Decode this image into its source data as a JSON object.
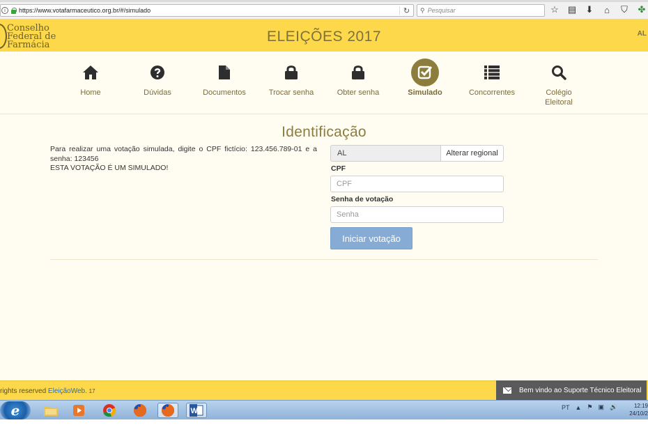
{
  "browser": {
    "url": "https://www.votafarmaceutico.org.br/#/simulado",
    "search_placeholder": "Pesquisar"
  },
  "header": {
    "logo_lines": [
      "Conselho",
      "Federal de",
      "Farmácia"
    ],
    "title": "ELEIÇÕES 2017",
    "region_code": "AL"
  },
  "nav": {
    "items": [
      {
        "label": "Home",
        "icon": "home-icon"
      },
      {
        "label": "Dúvidas",
        "icon": "question-icon"
      },
      {
        "label": "Documentos",
        "icon": "document-icon"
      },
      {
        "label": "Trocar senha",
        "icon": "lock-icon"
      },
      {
        "label": "Obter senha",
        "icon": "lock-icon"
      },
      {
        "label": "Simulado",
        "icon": "check-square-icon",
        "active": true
      },
      {
        "label": "Concorrentes",
        "icon": "list-icon"
      },
      {
        "label": "Colégio Eleitoral",
        "icon": "search-icon"
      }
    ]
  },
  "identification": {
    "title": "Identificação",
    "instructions": "Para realizar uma votação simulada, digite o CPF fictício: 123.456.789-01 e a senha: 123456",
    "warning": "ESTA VOTAÇÃO É UM SIMULADO!",
    "region_value": "AL",
    "change_region_label": "Alterar regional",
    "cpf_label": "CPF",
    "cpf_placeholder": "CPF",
    "password_label": "Senha de votação",
    "password_placeholder": "Senha",
    "start_button": "Iniciar votação"
  },
  "footer": {
    "text": "rights reserved",
    "link": "EleiçãoWeb.",
    "year": "17",
    "support": "Bem vindo ao Suporte Técnico Eleitoral"
  },
  "taskbar": {
    "language": "PT",
    "time": "12:19",
    "date": "24/10/2"
  },
  "colors": {
    "header_bg": "#fcd84a",
    "accent": "#8c7d3c",
    "button": "#86acd6"
  }
}
